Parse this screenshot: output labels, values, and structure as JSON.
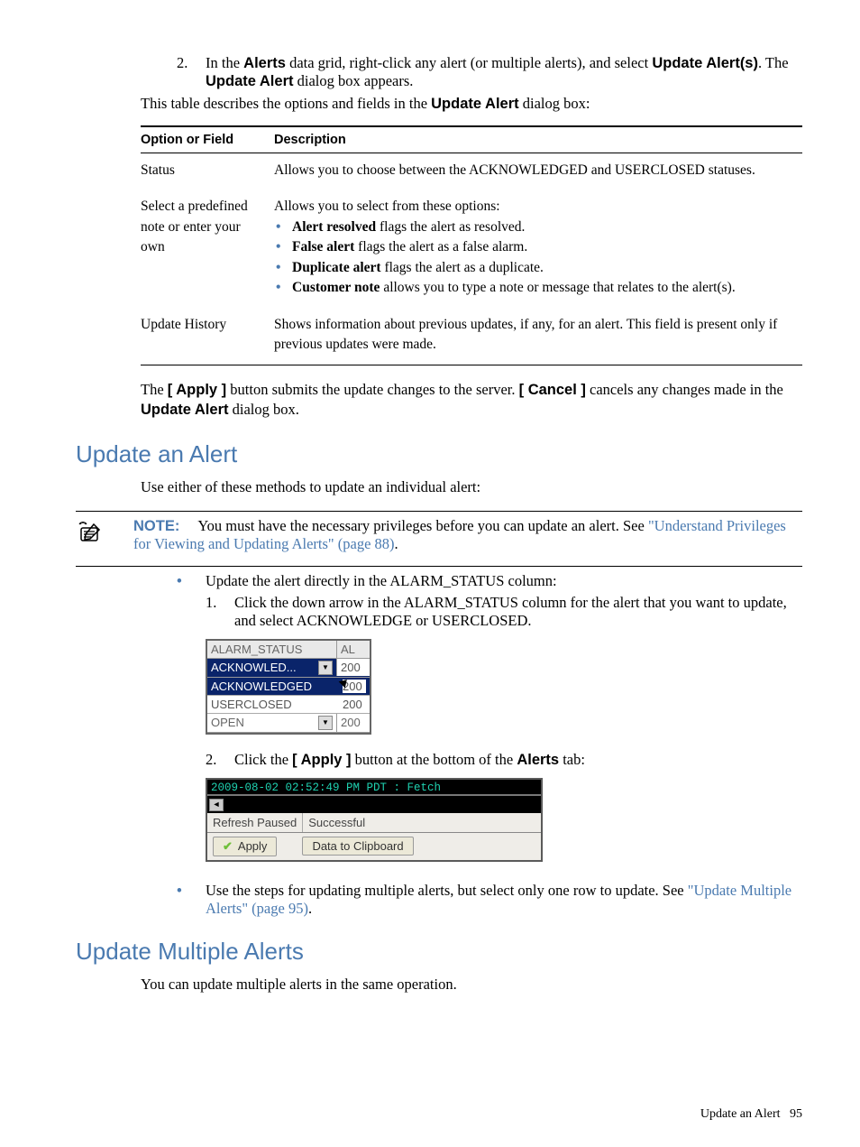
{
  "intro": {
    "step2_num": "2.",
    "step2_text_pre": "In the ",
    "step2_bold1": "Alerts",
    "step2_text_mid": " data grid, right-click any alert (or multiple alerts), and select ",
    "step2_bold2": "Update Alert(s)",
    "step2_text_mid2": ". The ",
    "step2_bold3": "Update Alert",
    "step2_text_end": " dialog box appears.",
    "table_intro_pre": "This table describes the options and fields in the ",
    "table_intro_bold": "Update Alert",
    "table_intro_end": " dialog box:"
  },
  "table": {
    "h1": "Option or Field",
    "h2": "Description",
    "r1c1": "Status",
    "r1c2": "Allows you to choose between the ACKNOWLEDGED and USERCLOSED statuses.",
    "r2c1": "Select a predefined note or enter your own",
    "r2c2_intro": "Allows you to select from these options:",
    "r2b1_b": "Alert resolved",
    "r2b1_t": " flags the alert as resolved.",
    "r2b2_b": "False alert",
    "r2b2_t": " flags the alert as a false alarm.",
    "r2b3_b": "Duplicate alert",
    "r2b3_t": " flags the alert as a duplicate.",
    "r2b4_b": "Customer note",
    "r2b4_t": " allows you to type a note or message that relates to the alert(s).",
    "r3c1": "Update History",
    "r3c2": "Shows information about previous updates, if any, for an alert. This field is present only if previous updates were made."
  },
  "paragraph2": {
    "pre": "The ",
    "b1": "[ Apply ]",
    "mid1": " button submits the update changes to the server. ",
    "b2": "[ Cancel ]",
    "mid2": " cancels any changes made in the ",
    "b3": "Update Alert",
    "end": " dialog box."
  },
  "section1": {
    "title": "Update an Alert",
    "intro": "Use either of these methods to update an individual alert:",
    "note_label": "NOTE:",
    "note_text": " You must have the necessary privileges before you can update an alert. See ",
    "note_link": "\"Understand Privileges for Viewing and Updating Alerts\" (page 88)",
    "note_end": ".",
    "bullet1": "Update the alert directly in the ALARM_STATUS column:",
    "s1_num": "1.",
    "s1_text": "Click the down arrow in the ALARM_STATUS column for the alert that you want to update, and select ACKNOWLEDGE or USERCLOSED.",
    "s2_num": "2.",
    "s2_pre": "Click the ",
    "s2_b": "[ Apply ]",
    "s2_mid": " button at the bottom of the ",
    "s2_b2": "Alerts",
    "s2_end": " tab:",
    "bullet2_pre": "Use the steps for updating multiple alerts, but select only one row to update. See ",
    "bullet2_link": "\"Update Multiple Alerts\" (page 95)",
    "bullet2_end": "."
  },
  "alarm": {
    "col1": "ALARM_STATUS",
    "col2": "AL",
    "sel": "ACKNOWLED...",
    "sel_v": "200",
    "opt1": "ACKNOWLEDGED",
    "opt1_v": "200",
    "opt2": "USERCLOSED",
    "opt2_v": "200",
    "open": "OPEN",
    "open_v": "200"
  },
  "apply_panel": {
    "log": "2009-08-02 02:52:49 PM PDT : Fetch",
    "status1": "Refresh Paused",
    "status2": "Successful",
    "btn1": "Apply",
    "btn2": "Data to Clipboard"
  },
  "section2": {
    "title": "Update Multiple Alerts",
    "intro": "You can update multiple alerts in the same operation."
  },
  "footer": {
    "text": "Update an Alert",
    "page": "95"
  }
}
